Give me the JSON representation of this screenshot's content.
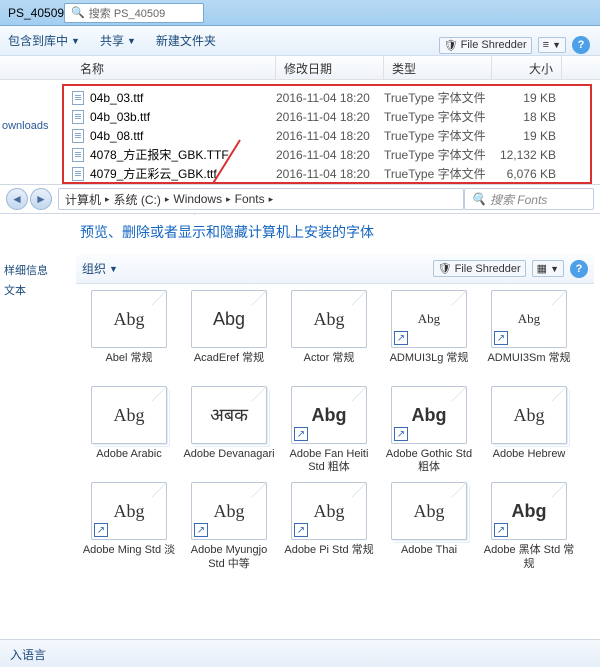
{
  "window_title": "PS_40509",
  "search_top": "搜索 PS_40509",
  "toolbar1": {
    "include": "包含到库中",
    "share": "共享",
    "newfolder": "新建文件夹",
    "shredder": "File Shredder"
  },
  "columns": {
    "name": "名称",
    "date": "修改日期",
    "type": "类型",
    "size": "大小"
  },
  "sidebar1": {
    "downloads": "ownloads"
  },
  "files": [
    {
      "name": "04b_03.ttf",
      "date": "2016-11-04 18:20",
      "type": "TrueType 字体文件",
      "size": "19 KB"
    },
    {
      "name": "04b_03b.ttf",
      "date": "2016-11-04 18:20",
      "type": "TrueType 字体文件",
      "size": "18 KB"
    },
    {
      "name": "04b_08.ttf",
      "date": "2016-11-04 18:20",
      "type": "TrueType 字体文件",
      "size": "19 KB"
    },
    {
      "name": "4078_方正报宋_GBK.TTF",
      "date": "2016-11-04 18:20",
      "type": "TrueType 字体文件",
      "size": "12,132 KB"
    },
    {
      "name": "4079_方正彩云_GBK.ttf",
      "date": "2016-11-04 18:20",
      "type": "TrueType 字体文件",
      "size": "6,076 KB"
    }
  ],
  "breadcrumb": [
    "计算机",
    "系统 (C:)",
    "Windows",
    "Fonts"
  ],
  "search_fonts": "搜索 Fonts",
  "heading": "预览、删除或者显示和隐藏计算机上安装的字体",
  "sidebar2": {
    "detail": "样细信息",
    "text": "文本"
  },
  "toolbar2": {
    "organize": "组织",
    "shredder": "File Shredder"
  },
  "fonts": [
    {
      "sample": "Abg",
      "label": "Abel 常规",
      "stack": false,
      "bold": false,
      "shortcut": false
    },
    {
      "sample": "Abg",
      "label": "AcadEref 常规",
      "stack": false,
      "bold": false,
      "shortcut": false,
      "alt": true
    },
    {
      "sample": "Abg",
      "label": "Actor 常规",
      "stack": false,
      "bold": false,
      "shortcut": false
    },
    {
      "sample": "Abg",
      "label": "ADMUI3Lg 常规",
      "stack": false,
      "bold": false,
      "shortcut": true,
      "small": true
    },
    {
      "sample": "Abg",
      "label": "ADMUI3Sm 常规",
      "stack": false,
      "bold": false,
      "shortcut": true,
      "small": true
    },
    {
      "sample": "Abg",
      "label": "Adobe Arabic",
      "stack": true,
      "bold": false,
      "shortcut": false
    },
    {
      "sample": "अबक",
      "label": "Adobe Devanagari",
      "stack": true,
      "bold": false,
      "shortcut": false
    },
    {
      "sample": "Abg",
      "label": "Adobe Fan Heiti Std 粗体",
      "stack": false,
      "bold": true,
      "shortcut": true,
      "sans": true
    },
    {
      "sample": "Abg",
      "label": "Adobe Gothic Std 粗体",
      "stack": false,
      "bold": true,
      "shortcut": true,
      "sans": true
    },
    {
      "sample": "Abg",
      "label": "Adobe Hebrew",
      "stack": true,
      "bold": false,
      "shortcut": false
    },
    {
      "sample": "Abg",
      "label": "Adobe Ming Std 淡",
      "stack": false,
      "bold": false,
      "shortcut": true
    },
    {
      "sample": "Abg",
      "label": "Adobe Myungjo Std 中等",
      "stack": false,
      "bold": false,
      "shortcut": true
    },
    {
      "sample": "Abg",
      "label": "Adobe Pi Std 常规",
      "stack": false,
      "bold": false,
      "shortcut": true
    },
    {
      "sample": "Abg",
      "label": "Adobe Thai",
      "stack": true,
      "bold": false,
      "shortcut": false
    },
    {
      "sample": "Abg",
      "label": "Adobe 黑体 Std 常规",
      "stack": false,
      "bold": true,
      "shortcut": true,
      "sans": true
    }
  ],
  "footer": "入语言"
}
